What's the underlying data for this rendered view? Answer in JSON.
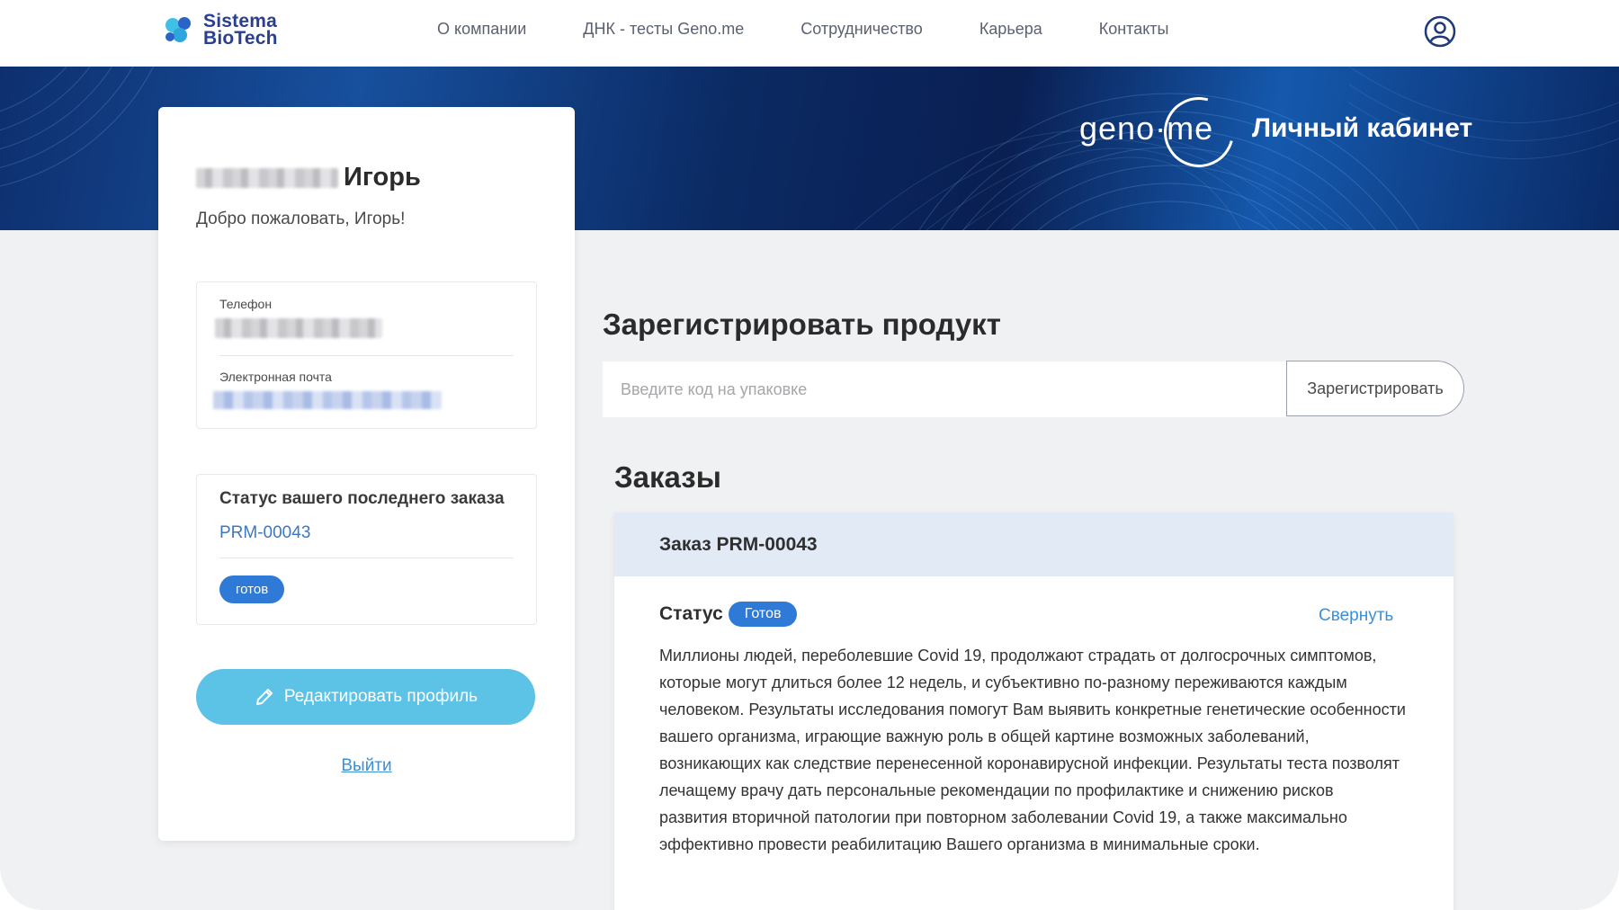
{
  "brand": {
    "logo_line1": "Sistema",
    "logo_line2": "BioTech",
    "logo_colors": [
      "#3fc0e6",
      "#2a64c8"
    ]
  },
  "nav": {
    "items": [
      {
        "label": "О компании"
      },
      {
        "label": "ДНК - тесты Geno.me"
      },
      {
        "label": "Сотрудничество"
      },
      {
        "label": "Карьера"
      },
      {
        "label": "Контакты"
      }
    ],
    "account_icon": "user-circle-icon"
  },
  "hero": {
    "logo_text": "geno·me",
    "title": "Личный кабинет"
  },
  "profile": {
    "first_name": "Игорь",
    "welcome": "Добро пожаловать, Игорь!",
    "phone_label": "Телефон",
    "email_label": "Электронная почта",
    "last_order_title": "Статус вашего последнего заказа",
    "last_order_id": "PRM-00043",
    "last_order_status": "готов",
    "edit_button": "Редактировать профиль",
    "edit_icon": "pencil-icon",
    "logout": "Выйти"
  },
  "register": {
    "title": "Зарегистрировать продукт",
    "placeholder": "Введите код на упаковке",
    "button": "Зарегистрировать"
  },
  "orders": {
    "title": "Заказы",
    "order": {
      "header": "Заказ PRM-00043",
      "status_label": "Статус",
      "status_value": "Готов",
      "collapse": "Свернуть",
      "description": "Миллионы людей, переболевшие Covid 19, продолжают страдать от долгосрочных симптомов, которые могут длиться более 12 недель, и субъективно по-разному переживаются каждым человеком. Результаты исследования помогут Вам выявить конкретные генетические особенности вашего организма, играющие важную роль в общей картине возможных заболеваний, возникающих как следствие перенесенной коронавирусной инфекции. Результаты теста позволят лечащему врачу дать персональные рекомендации по профилактике и снижению рисков развития вторичной патологии при повторном заболевании Covid 19, а также максимально эффективно провести реабилитацию Вашего организма в минимальные сроки."
    }
  },
  "colors": {
    "accent_blue": "#2f7ad6",
    "link_blue": "#3b8fd6",
    "edit_button": "#5cc2e6",
    "order_header_bg": "#e2eaf6"
  }
}
